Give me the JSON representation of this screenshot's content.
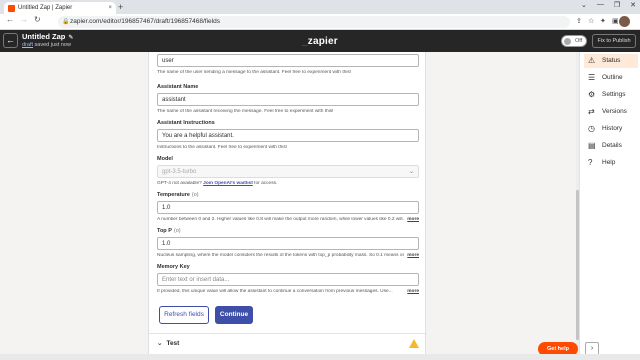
{
  "browser": {
    "tab_title": "Untitled Zap | Zapier",
    "tab_close": "×",
    "new_tab": "+",
    "url": "zapier.com/editor/196857467/draft/196857468/fields",
    "window_controls": [
      "⌄",
      "—",
      "❐",
      "✕"
    ]
  },
  "appbar": {
    "zap_title": "Untitled Zap",
    "saved_link": "draft",
    "saved_text": "saved just now",
    "logo_prefix": "_",
    "logo_text": "zapier",
    "toggle_label": "Off",
    "publish_label": "Fix to Publish"
  },
  "form": {
    "user_name": {
      "value": "user",
      "help": "The name of the user sending a message to the assistant. Feel free to experiment with this!"
    },
    "assistant_name": {
      "label": "Assistant Name",
      "value": "assistant",
      "help": "The name of the assistant receiving the message. Feel free to experiment with this!"
    },
    "assistant_instructions": {
      "label": "Assistant Instructions",
      "value": "You are a helpful assistant.",
      "help": "Instructions to the assistant. Feel free to experiment with this!"
    },
    "model": {
      "label": "Model",
      "value": "gpt-3.5-turbo",
      "help_prefix": "GPT-4 not available?",
      "help_link": "Join OpenAI's waitlist",
      "help_suffix": "for access."
    },
    "temperature": {
      "label": "Temperature",
      "optional": "(o)",
      "value": "1.0",
      "help": "A number between 0 and 2. Higher values like 0.8 will make the output more random, while lower values like 0.2 will...",
      "more": "more"
    },
    "top_p": {
      "label": "Top P",
      "optional": "(o)",
      "value": "1.0",
      "help": "Nucleus sampling, where the model considers the results of the tokens with top_p probability mass. So 0.1 means onl...",
      "more": "more"
    },
    "memory_key": {
      "label": "Memory Key",
      "placeholder": "Enter text or insert data...",
      "help": "If provided, this unique value will allow the assistant to continue a conversation from previous messages. Use...",
      "more": "more"
    },
    "refresh_label": "Refresh fields",
    "continue_label": "Continue"
  },
  "test_section": {
    "label": "Test"
  },
  "sidebar": {
    "items": [
      {
        "label": "Status",
        "icon": "⚠"
      },
      {
        "label": "Outline",
        "icon": "☰"
      },
      {
        "label": "Settings",
        "icon": "⚙"
      },
      {
        "label": "Versions",
        "icon": "⇄"
      },
      {
        "label": "History",
        "icon": "◷"
      },
      {
        "label": "Details",
        "icon": "▤"
      },
      {
        "label": "Help",
        "icon": "?"
      }
    ]
  },
  "get_help": "Get help",
  "collapse": "›",
  "colors": {
    "accent": "#ff4a00",
    "primary": "#3d4fa8",
    "warning": "#f5b72c"
  }
}
